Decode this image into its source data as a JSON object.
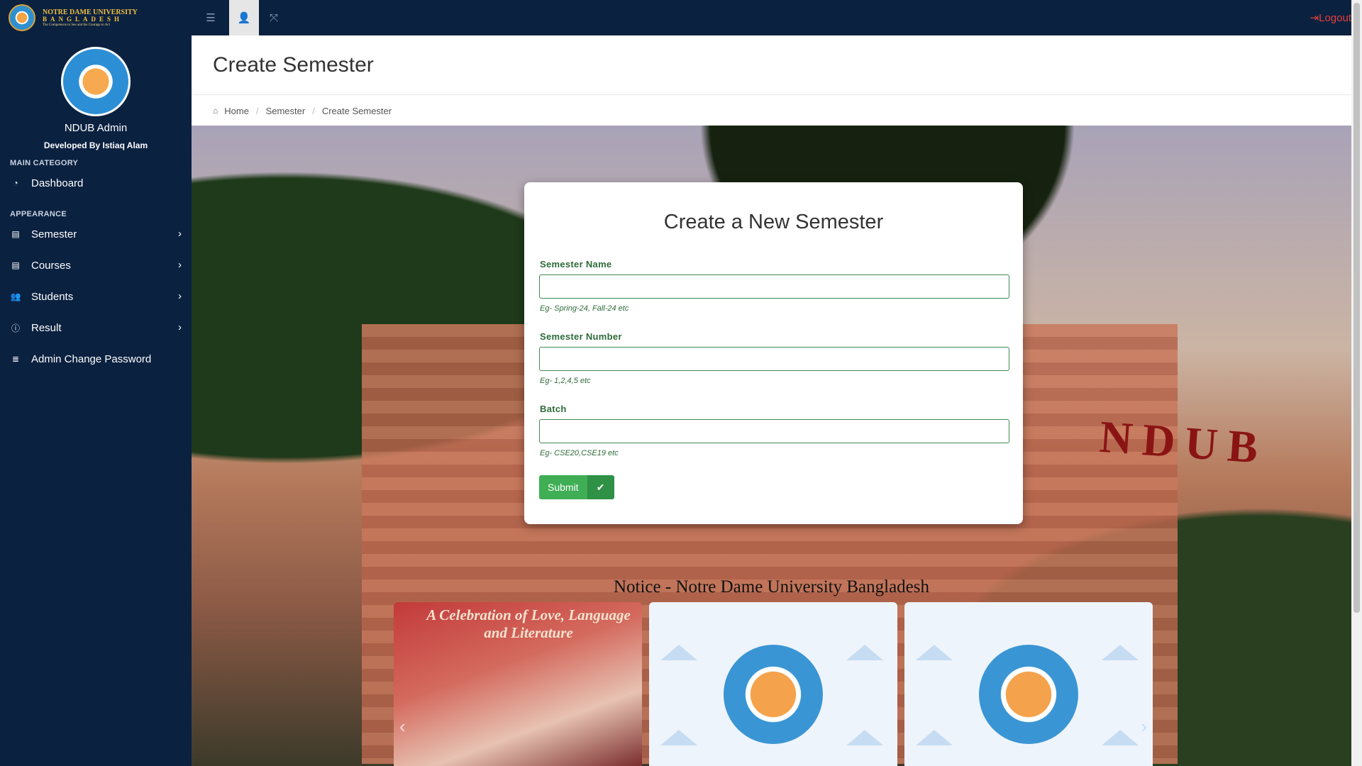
{
  "topbar": {
    "brand_line1": "NOTRE DAME UNIVERSITY",
    "brand_line2": "BANGLADESH",
    "brand_line3": "The Competence to See and the Courage to Act",
    "logout_label": "Logout"
  },
  "sidebar": {
    "admin_name": "NDUB Admin",
    "developer": "Developed By Istiaq Alam",
    "heading_main": "MAIN CATEGORY",
    "heading_appearance": "APPEARANCE",
    "items": [
      {
        "label": "Dashboard",
        "icon": "dashboard-icon"
      },
      {
        "label": "Semester",
        "icon": "file-icon"
      },
      {
        "label": "Courses",
        "icon": "file-icon"
      },
      {
        "label": "Students",
        "icon": "users-icon"
      },
      {
        "label": "Result",
        "icon": "info-icon"
      },
      {
        "label": "Admin Change Password",
        "icon": "list-icon"
      }
    ]
  },
  "page": {
    "title": "Create Semester",
    "breadcrumb": [
      "Home",
      "Semester",
      "Create Semester"
    ]
  },
  "hero": {
    "sign_text": "NDUB"
  },
  "form": {
    "title": "Create a New Semester",
    "fields": [
      {
        "label": "Semester Name",
        "value": "",
        "help": "Eg- Spring-24, Fall-24 etc"
      },
      {
        "label": "Semester Number",
        "value": "",
        "help": "Eg- 1,2,4,5 etc"
      },
      {
        "label": "Batch",
        "value": "",
        "help": "Eg- CSE20,CSE19 etc"
      }
    ],
    "submit_label": "Submit"
  },
  "notice": {
    "title": "Notice - Notre Dame University Bangladesh",
    "photo_caption": "A Celebration of Love, Language and Literature"
  },
  "colors": {
    "sidebar_bg": "#0b2140",
    "accent_green": "#3fae54",
    "label_green": "#2e6b3a",
    "logout_red": "#e0413b"
  }
}
